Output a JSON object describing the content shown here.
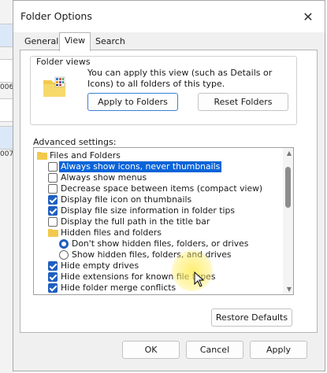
{
  "window": {
    "title": "Folder Options",
    "close_glyph": "✕"
  },
  "background": {
    "file_captions": [
      "006",
      "007"
    ]
  },
  "tabs": [
    {
      "label": "General",
      "active": false
    },
    {
      "label": "View",
      "active": true
    },
    {
      "label": "Search",
      "active": false
    }
  ],
  "folder_views": {
    "label": "Folder views",
    "description": "You can apply this view (such as Details or Icons) to all folders of this type.",
    "apply_button": "Apply to Folders",
    "reset_button": "Reset Folders"
  },
  "advanced": {
    "label": "Advanced settings:",
    "items": [
      {
        "type": "folder",
        "label": "Files and Folders"
      },
      {
        "type": "checkbox",
        "label": "Always show icons, never thumbnails",
        "checked": false,
        "selected": true
      },
      {
        "type": "checkbox",
        "label": "Always show menus",
        "checked": false
      },
      {
        "type": "checkbox",
        "label": "Decrease space between items (compact view)",
        "checked": false
      },
      {
        "type": "checkbox",
        "label": "Display file icon on thumbnails",
        "checked": true
      },
      {
        "type": "checkbox",
        "label": "Display file size information in folder tips",
        "checked": true
      },
      {
        "type": "checkbox",
        "label": "Display the full path in the title bar",
        "checked": false
      },
      {
        "type": "folder",
        "label": "Hidden files and folders"
      },
      {
        "type": "radio",
        "label": "Don't show hidden files, folders, or drives",
        "checked": true
      },
      {
        "type": "radio",
        "label": "Show hidden files, folders, and drives",
        "checked": false
      },
      {
        "type": "checkbox",
        "label": "Hide empty drives",
        "checked": true
      },
      {
        "type": "checkbox",
        "label": "Hide extensions for known file types",
        "checked": true
      },
      {
        "type": "checkbox",
        "label": "Hide folder merge conflicts",
        "checked": true
      }
    ]
  },
  "buttons": {
    "restore_defaults": "Restore Defaults",
    "ok": "OK",
    "cancel": "Cancel",
    "apply": "Apply"
  },
  "colors": {
    "accent": "#1f5fbf",
    "selection": "#0a64d8",
    "cursor_highlight": "#ffec5a"
  }
}
